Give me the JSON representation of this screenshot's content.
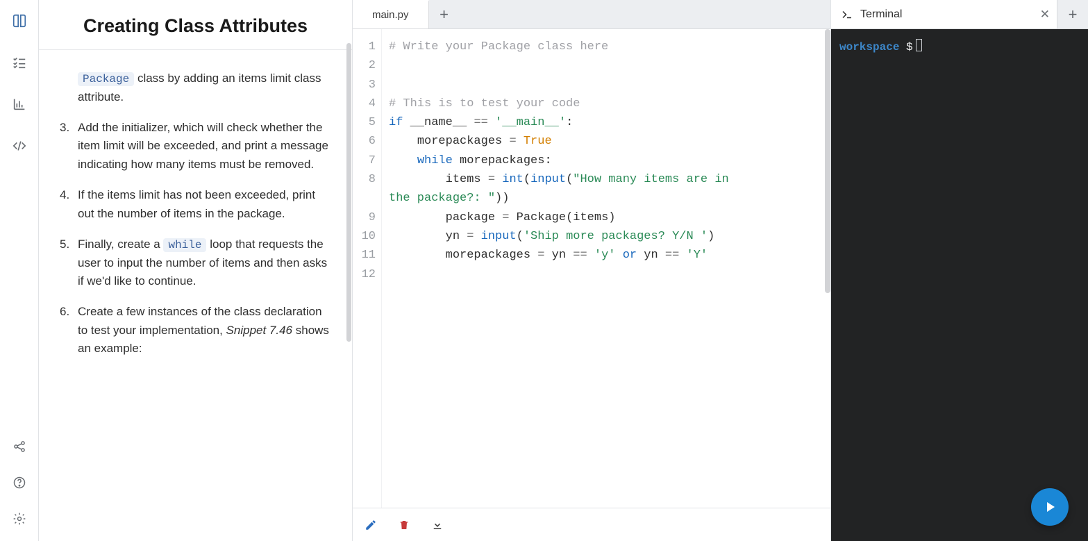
{
  "title": "Creating Class Attributes",
  "instructions": [
    {
      "marker": "",
      "pill": "Package",
      "post": " class by adding an items limit class attribute.",
      "pre": ""
    },
    {
      "marker": "3.",
      "text": "Add the initializer, which will check whether the item limit will be exceeded, and print a message indicating how many items must be removed."
    },
    {
      "marker": "4.",
      "text": "If the items limit has not been exceeded, print out the number of items in the package."
    },
    {
      "marker": "5.",
      "pre": "Finally, create a ",
      "pill": "while",
      "post": " loop that requests the user to input the number of items and then asks if we'd like to continue."
    },
    {
      "marker": "6.",
      "pre": "Create a few instances of the class declaration to test your implementation, ",
      "em": "Snippet 7.46",
      "post": " shows an example:"
    }
  ],
  "editor": {
    "tab": "main.py",
    "lines": [
      "1",
      "2",
      "3",
      "4",
      "5",
      "6",
      "7",
      "8",
      "9",
      "10",
      "11",
      "12"
    ],
    "code": {
      "l1": "# Write your Package class here",
      "l4": "# This is to test your code",
      "kw_if": "if",
      "name_dunder": "__name__",
      "eq": "==",
      "str_main": "'__main__'",
      "colon": ":",
      "var_more": "morepackages",
      "assign": "=",
      "bool_true": "True",
      "kw_while": "while",
      "var_more2": "morepackages",
      "colon2": ":",
      "var_items": "items",
      "assign2": "=",
      "bi_int": "int",
      "paren_o": "(",
      "bi_input": "input",
      "paren_o2": "(",
      "str_prompt": "\"How many items are in the package?: \"",
      "paren_c": ")",
      "paren_c2": ")",
      "var_pkg": "package",
      "assign3": "=",
      "cls_pkg": "Package",
      "paren_o3": "(",
      "arg_items": "items",
      "paren_c3": ")",
      "var_yn": "yn",
      "assign4": "=",
      "bi_input2": "input",
      "paren_o4": "(",
      "str_ship": "'Ship more packages? Y/N '",
      "paren_c4": ")",
      "var_more3": "morepackages",
      "assign5": "=",
      "var_yn2": "yn",
      "eq2": "==",
      "str_y": "'y'",
      "kw_or": "or",
      "var_yn3": "yn",
      "eq3": "==",
      "str_Y": "'Y'"
    }
  },
  "terminal": {
    "tab": "Terminal",
    "prompt_ws": "workspace",
    "prompt_d": "$"
  }
}
